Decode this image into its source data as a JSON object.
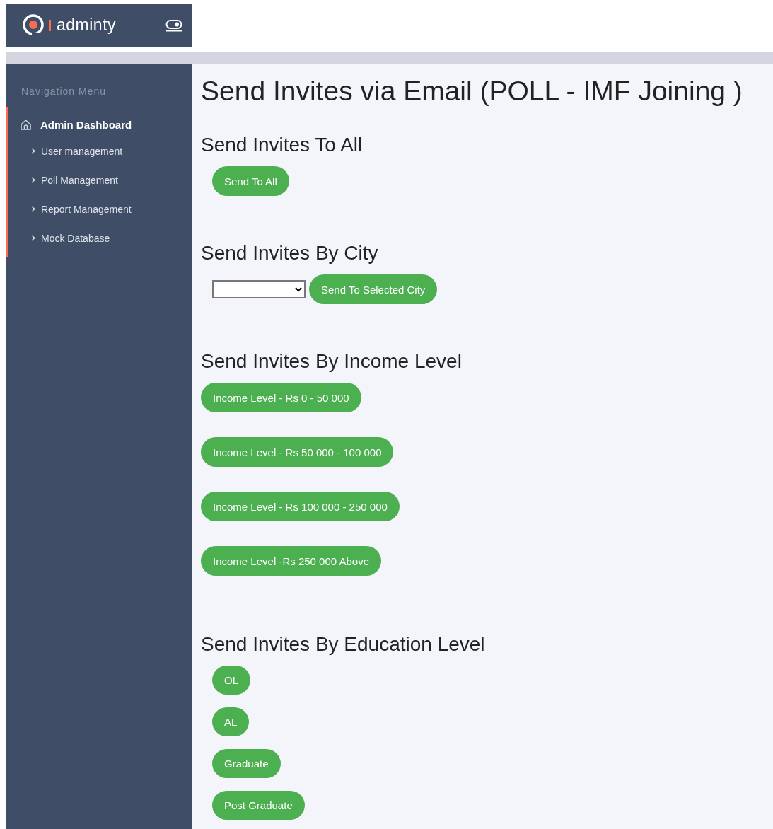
{
  "brand": {
    "name": "adminty"
  },
  "nav": {
    "heading": "Navigation Menu",
    "items": [
      {
        "label": "Admin Dashboard",
        "expanded": true,
        "children": [
          {
            "label": "User management"
          },
          {
            "label": "Poll Management"
          },
          {
            "label": "Report Management"
          },
          {
            "label": "Mock Database"
          }
        ]
      }
    ]
  },
  "page_title": "Send Invites via Email (POLL - IMF Joining )",
  "sections": [
    {
      "kind": "all",
      "title": "Send Invites To All",
      "buttons": [
        "Send To All"
      ]
    },
    {
      "kind": "city",
      "title": "Send Invites By City",
      "select": {
        "kind": "dropdown"
      },
      "buttons": [
        "Send To Selected City"
      ]
    },
    {
      "kind": "income",
      "title": "Send Invites By Income Level",
      "buttons": [
        "Income Level - Rs 0 - 50 000",
        "Income Level - Rs 50 000 - 100 000",
        "Income Level - Rs 100 000 - 250 000",
        "Income Level -Rs 250 000 Above"
      ]
    },
    {
      "kind": "education",
      "title": "Send Invites By Education Level",
      "buttons": [
        "OL",
        "AL",
        "Graduate",
        "Post Graduate"
      ]
    }
  ]
}
